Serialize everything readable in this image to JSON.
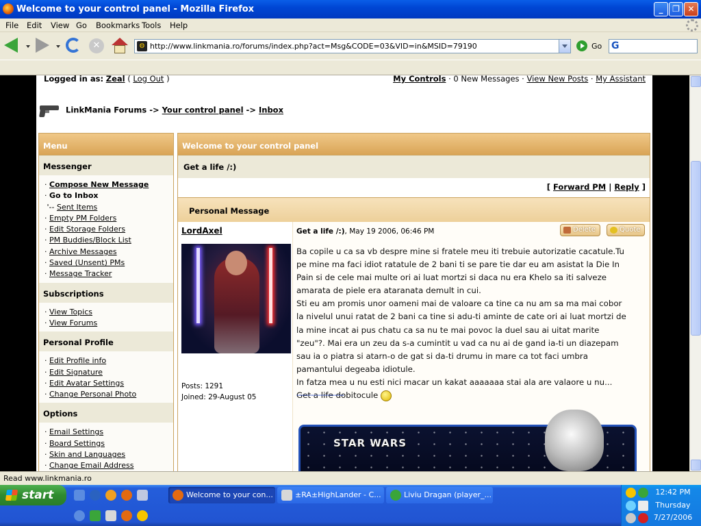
{
  "window": {
    "title": "Welcome to your control panel - Mozilla Firefox"
  },
  "menubar": {
    "items": [
      "File",
      "Edit",
      "View",
      "Go",
      "Bookmarks",
      "Tools",
      "Help"
    ]
  },
  "navbar": {
    "url": "http://www.linkmania.ro/forums/index.php?act=Msg&CODE=03&VID=in&MSID=79190",
    "go_label": "Go"
  },
  "userbar": {
    "logged_in_label": "Logged in as:",
    "username": "Zeal",
    "logout": "Log Out",
    "my_controls": "My Controls",
    "new_messages": "0 New Messages",
    "view_new_posts": "View New Posts",
    "my_assistant": "My Assistant"
  },
  "breadcrumb": {
    "root": "LinkMania Forums",
    "sep": "->",
    "cp": "Your control panel",
    "inbox": "Inbox"
  },
  "menu": {
    "title": "Menu",
    "messenger": {
      "title": "Messenger",
      "items": [
        "Compose New Message",
        "Go to Inbox",
        "Sent Items",
        "Empty PM Folders",
        "Edit Storage Folders",
        "PM Buddies/Block List",
        "Archive Messages",
        "Saved (Unsent) PMs",
        "Message Tracker"
      ]
    },
    "subscriptions": {
      "title": "Subscriptions",
      "items": [
        "View Topics",
        "View Forums"
      ]
    },
    "profile": {
      "title": "Personal Profile",
      "items": [
        "Edit Profile info",
        "Edit Signature",
        "Edit Avatar Settings",
        "Change Personal Photo"
      ]
    },
    "options": {
      "title": "Options",
      "items": [
        "Email Settings",
        "Board Settings",
        "Skin and Languages",
        "Change Email Address"
      ]
    }
  },
  "main": {
    "title": "Welcome to your control panel",
    "subject": "Get a life /:)",
    "forward": "Forward PM",
    "reply": "Reply",
    "pm_title": "Personal Message"
  },
  "post": {
    "author": "LordAxel",
    "subject": "Get a life /:)",
    "date": ", May 19 2006, 06:46 PM",
    "delete": "Delete",
    "quote": "Quote",
    "posts": "Posts: 1291",
    "joined": "Joined: 29-August 05",
    "lines": [
      "Ba copile u ca sa vb despre mine si fratele meu iti trebuie autorizatie cacatule.Tu",
      "pe mine ma faci idiot ratatule de 2 bani ti se pare tie dar eu am asistat la Die In",
      "Pain si de cele mai multe ori ai luat mortzi si daca nu era Khelo sa iti salveze",
      "amarata de piele era ataranata demult in cui.",
      "Sti eu am promis unor oameni mai de valoare ca tine ca nu am sa ma mai cobor",
      "la nivelul unui ratat de 2 bani ca tine si adu-ti aminte de cate ori ai luat mortzi de",
      "la mine incat ai pus chatu ca sa nu te mai povoc la duel sau ai uitat marite",
      "\"zeu\"?. Mai era un zeu da s-a cumintit u vad ca nu ai de gand ia-ti un diazepam",
      "sau ia o piatra si atarn-o de gat si da-ti drumu in mare ca tot faci umbra",
      "pamantului degeaba idiotule.",
      "In fatza mea u nu esti nici macar un kakat aaaaaaa stai ala are valaore u nu...",
      "Get a life dobitocule"
    ],
    "signature_line": "--------------------",
    "banner_text": "STAR WARS"
  },
  "status": {
    "text": "Read www.linkmania.ro"
  },
  "taskbar": {
    "start": "start",
    "tasks": [
      "Welcome to your con...",
      "±RA±HighLander - C...",
      "Liviu Dragan (player_..."
    ],
    "clock": {
      "time": "12:42 PM",
      "day": "Thursday",
      "date": "7/27/2006"
    }
  }
}
